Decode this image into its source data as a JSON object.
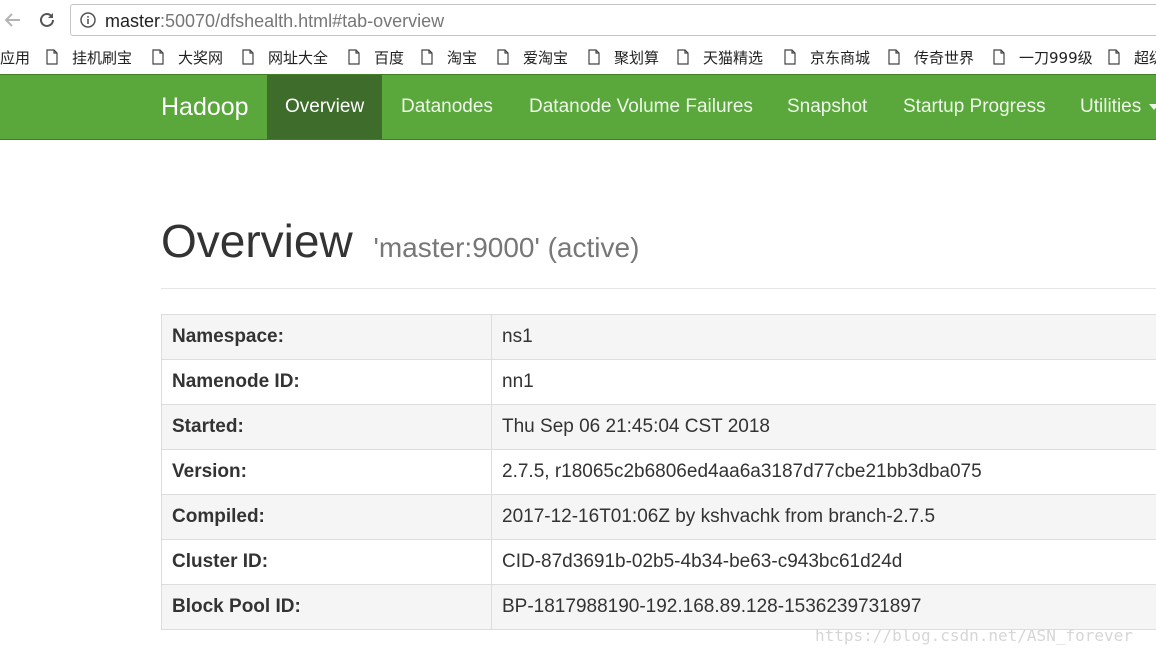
{
  "browser": {
    "url_host": "master",
    "url_rest": ":50070/dfshealth.html#tab-overview",
    "bookmarks": [
      {
        "label": "应用",
        "icon": "apps-icon"
      },
      {
        "label": "挂机刷宝",
        "icon": "page-icon"
      },
      {
        "label": "大奖网",
        "icon": "page-icon"
      },
      {
        "label": "网址大全",
        "icon": "page-icon"
      },
      {
        "label": "百度",
        "icon": "page-icon"
      },
      {
        "label": "淘宝",
        "icon": "page-icon"
      },
      {
        "label": "爱淘宝",
        "icon": "page-icon"
      },
      {
        "label": "聚划算",
        "icon": "page-icon"
      },
      {
        "label": "天猫精选",
        "icon": "page-icon"
      },
      {
        "label": "京东商城",
        "icon": "page-icon"
      },
      {
        "label": "传奇世界",
        "icon": "page-icon"
      },
      {
        "label": "一刀999级",
        "icon": "page-icon"
      },
      {
        "label": "超级",
        "icon": "page-icon"
      }
    ]
  },
  "navbar": {
    "brand": "Hadoop",
    "items": [
      {
        "label": "Overview",
        "active": true
      },
      {
        "label": "Datanodes"
      },
      {
        "label": "Datanode Volume Failures"
      },
      {
        "label": "Snapshot"
      },
      {
        "label": "Startup Progress"
      },
      {
        "label": "Utilities",
        "dropdown": true
      }
    ],
    "colors": {
      "bar": "#5aa83b",
      "active": "#3e6c2b"
    }
  },
  "overview": {
    "title": "Overview",
    "subtitle": "'master:9000' (active)",
    "rows": [
      {
        "key": "Namespace:",
        "value": "ns1"
      },
      {
        "key": "Namenode ID:",
        "value": "nn1"
      },
      {
        "key": "Started:",
        "value": "Thu Sep 06 21:45:04 CST 2018"
      },
      {
        "key": "Version:",
        "value": "2.7.5, r18065c2b6806ed4aa6a3187d77cbe21bb3dba075"
      },
      {
        "key": "Compiled:",
        "value": "2017-12-16T01:06Z by kshvachk from branch-2.7.5"
      },
      {
        "key": "Cluster ID:",
        "value": "CID-87d3691b-02b5-4b34-be63-c943bc61d24d"
      },
      {
        "key": "Block Pool ID:",
        "value": "BP-1817988190-192.168.89.128-1536239731897"
      }
    ]
  },
  "watermark": "https://blog.csdn.net/ASN_forever"
}
